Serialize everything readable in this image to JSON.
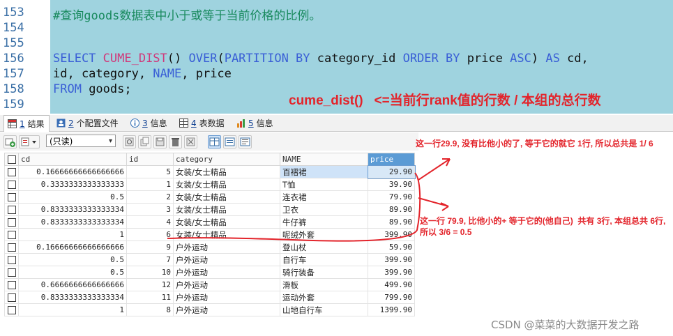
{
  "editor": {
    "lines": [
      {
        "num": "153",
        "parts": [
          {
            "t": "#查询goods数据表中小于或等于当前价格的比例。",
            "c": "cm"
          }
        ]
      },
      {
        "num": "154",
        "parts": []
      },
      {
        "num": "155",
        "parts": []
      },
      {
        "num": "156",
        "parts": [
          {
            "t": "SELECT ",
            "c": "kw"
          },
          {
            "t": "CUME_DIST",
            "c": "fn"
          },
          {
            "t": "() ",
            "c": ""
          },
          {
            "t": "OVER",
            "c": "kw"
          },
          {
            "t": "(",
            "c": ""
          },
          {
            "t": "PARTITION BY ",
            "c": "kw"
          },
          {
            "t": "category_id ",
            "c": ""
          },
          {
            "t": "ORDER BY ",
            "c": "kw"
          },
          {
            "t": "price ",
            "c": ""
          },
          {
            "t": "ASC",
            "c": "kw"
          },
          {
            "t": ") ",
            "c": ""
          },
          {
            "t": "AS ",
            "c": "kw"
          },
          {
            "t": "cd,",
            "c": ""
          }
        ]
      },
      {
        "num": "157",
        "parts": [
          {
            "t": "id, category, ",
            "c": ""
          },
          {
            "t": "NAME",
            "c": "kw"
          },
          {
            "t": ", price",
            "c": ""
          }
        ]
      },
      {
        "num": "158",
        "parts": [
          {
            "t": "FROM ",
            "c": "kw"
          },
          {
            "t": "goods;",
            "c": ""
          }
        ]
      },
      {
        "num": "159",
        "parts": []
      }
    ],
    "annotation": "cume_dist()   <=当前行rank值的行数 / 本组的总行数"
  },
  "tabs": [
    {
      "num": "1",
      "label": "结果",
      "icon": "result-grid-icon"
    },
    {
      "num": "2",
      "label": "个配置文件",
      "icon": "profile-icon"
    },
    {
      "num": "3",
      "label": "信息",
      "icon": "info-icon"
    },
    {
      "num": "4",
      "label": "表数据",
      "icon": "table-data-icon"
    },
    {
      "num": "5",
      "label": "信息",
      "icon": "info-icon"
    }
  ],
  "toolbar": {
    "readonly_label": "(只读)"
  },
  "grid": {
    "columns": [
      "cd",
      "id",
      "category",
      "NAME",
      "price"
    ],
    "sorted_column": "price",
    "rows": [
      [
        "0.16666666666666666",
        "5",
        "女装/女士精品",
        "百褶裙",
        "29.90"
      ],
      [
        "0.3333333333333333",
        "1",
        "女装/女士精品",
        "T恤",
        "39.90"
      ],
      [
        "0.5",
        "2",
        "女装/女士精品",
        "连衣裙",
        "79.90"
      ],
      [
        "0.8333333333333334",
        "3",
        "女装/女士精品",
        "卫衣",
        "89.90"
      ],
      [
        "0.8333333333333334",
        "4",
        "女装/女士精品",
        "牛仔裤",
        "89.90"
      ],
      [
        "1",
        "6",
        "女装/女士精品",
        "呢绒外套",
        "399.90"
      ],
      [
        "0.16666666666666666",
        "9",
        "户外运动",
        "登山杖",
        "59.90"
      ],
      [
        "0.5",
        "7",
        "户外运动",
        "自行车",
        "399.90"
      ],
      [
        "0.5",
        "10",
        "户外运动",
        "骑行装备",
        "399.90"
      ],
      [
        "0.6666666666666666",
        "12",
        "户外运动",
        "滑板",
        "499.90"
      ],
      [
        "0.8333333333333334",
        "11",
        "户外运动",
        "运动外套",
        "799.90"
      ],
      [
        "1",
        "8",
        "户外运动",
        "山地自行车",
        "1399.90"
      ]
    ]
  },
  "annotations": {
    "top": "这一行29.9, 没有比他小的了, 等于它的就它 1行, 所以总共是 1/ 6",
    "middle_line1": "这一行 79.9, 比他小的+ 等于它的(他自己)  共有 3行, 本组总共 6行,",
    "middle_line2": "所以 3/6 = 0.5"
  },
  "watermark": "CSDN @菜菜的大数据开发之路",
  "colors": {
    "annotation": "#e3242b",
    "editor_bg": "#9fd3df",
    "sorted_header": "#5b9bd5"
  }
}
